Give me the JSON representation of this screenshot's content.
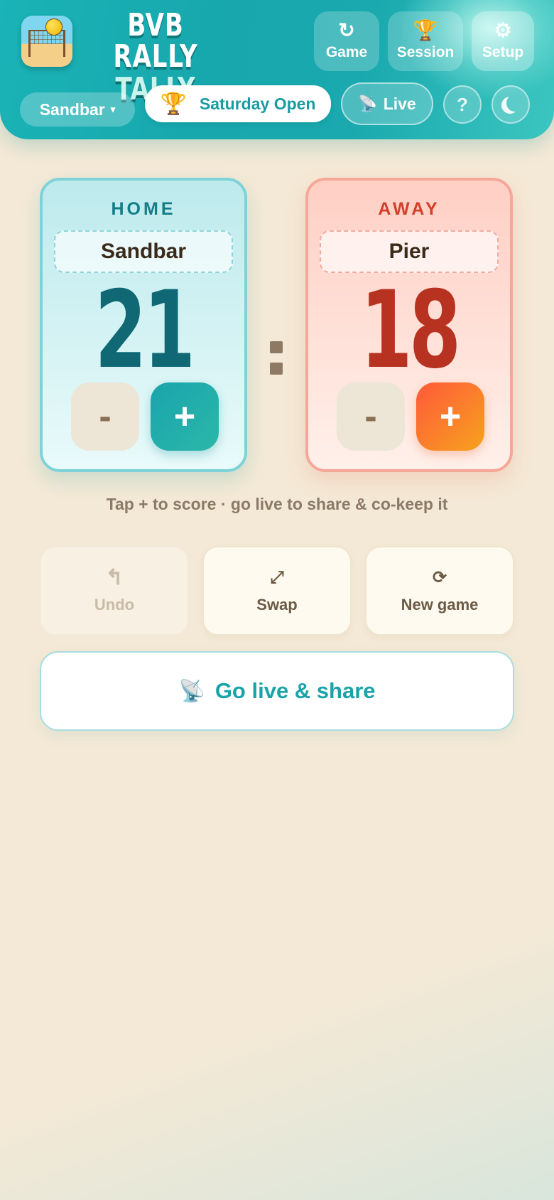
{
  "app": {
    "title_line1": "BVB RALLY",
    "title_line2": "TALLY"
  },
  "header": {
    "buttons": [
      {
        "label": "Game",
        "icon": "refresh-icon",
        "glyph": "↻"
      },
      {
        "label": "Session",
        "icon": "trophy-icon",
        "glyph": "🏆"
      },
      {
        "label": "Setup",
        "icon": "gear-icon",
        "glyph": "⚙"
      }
    ],
    "team_select": {
      "value": "Sandbar",
      "caret": "▾"
    },
    "event": {
      "label": "Saturday Open",
      "icon": "trophy-icon",
      "glyph": "🏆"
    },
    "live": {
      "label": "Live",
      "icon": "satellite-icon",
      "glyph": "📡"
    },
    "help": {
      "glyph": "?",
      "icon": "help-icon"
    },
    "theme": {
      "icon": "moon-icon"
    }
  },
  "home": {
    "label": "HOME",
    "team": "Sandbar",
    "score": 21,
    "minus": "-",
    "plus": "+"
  },
  "away": {
    "label": "AWAY",
    "team": "Pier",
    "score": 18,
    "minus": "-",
    "plus": "+"
  },
  "hint": "Tap + to score · go live to share & co-keep it",
  "actions": {
    "undo": {
      "label": "Undo",
      "glyph": "↰",
      "disabled": true
    },
    "swap": {
      "label": "Swap",
      "glyph": "⤢"
    },
    "new_game": {
      "label": "New game",
      "glyph": "⟳"
    }
  },
  "go_live": {
    "label": "Go live & share",
    "glyph": "📡",
    "icon": "satellite-icon"
  },
  "colors": {
    "header": "#1aa9ae",
    "home_accent": "#137d86",
    "away_accent": "#d3402a",
    "background": "#f4e9d6"
  }
}
